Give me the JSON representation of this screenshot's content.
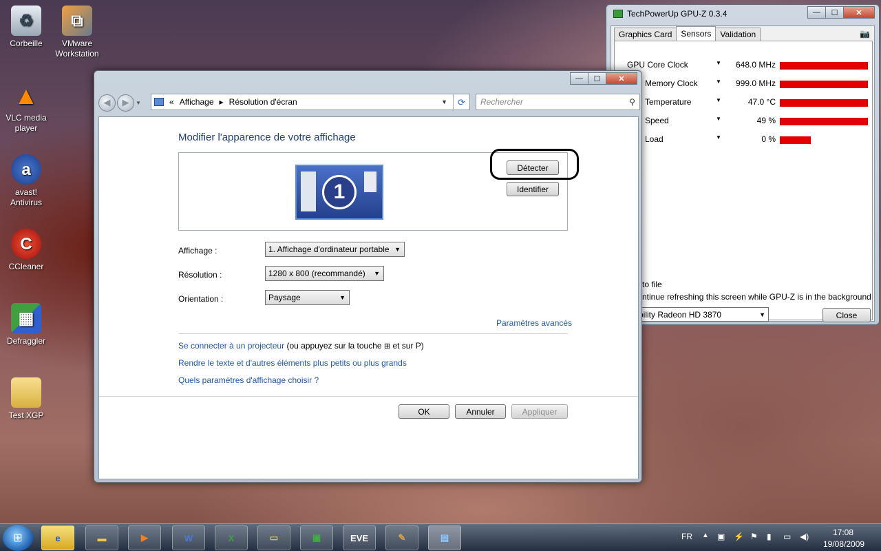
{
  "desktop": {
    "icons": [
      {
        "label": "Corbeille",
        "icon": "recycle-bin-icon"
      },
      {
        "label": "VMware Workstation",
        "icon": "vmware-icon"
      },
      {
        "label": "VLC media player",
        "icon": "vlc-icon"
      },
      {
        "label": "avast! Antivirus",
        "icon": "avast-icon"
      },
      {
        "label": "CCleaner",
        "icon": "ccleaner-icon"
      },
      {
        "label": "Defraggler",
        "icon": "defraggler-icon"
      },
      {
        "label": "Test XGP",
        "icon": "folder-icon"
      }
    ]
  },
  "explorer": {
    "breadcrumb": [
      "Affichage",
      "Résolution d'écran"
    ],
    "breadcrumb_prefix": "«",
    "search_placeholder": "Rechercher",
    "heading": "Modifier l'apparence de votre affichage",
    "monitor_number": "1",
    "detect_label": "Détecter",
    "identify_label": "Identifier",
    "display_label": "Affichage :",
    "display_value": "1. Affichage d'ordinateur portable",
    "resolution_label": "Résolution :",
    "resolution_value": "1280 x 800 (recommandé)",
    "orientation_label": "Orientation :",
    "orientation_value": "Paysage",
    "advanced_link": "Paramètres avancés",
    "projector_link": "Se connecter à un projecteur",
    "projector_hint_before": "(ou appuyez sur la touche",
    "projector_hint_after": "et sur P)",
    "text_size_link": "Rendre le texte et d'autres éléments plus petits ou plus grands",
    "which_settings_link": "Quels paramètres d'affichage choisir ?",
    "ok_label": "OK",
    "cancel_label": "Annuler",
    "apply_label": "Appliquer"
  },
  "gpuz": {
    "title": "TechPowerUp GPU-Z 0.3.4",
    "tabs": [
      "Graphics Card",
      "Sensors",
      "Validation"
    ],
    "active_tab": "Sensors",
    "sensors": [
      {
        "name": "GPU Core Clock",
        "value": "648.0 MHz",
        "level": 1.0
      },
      {
        "name": "Memory Clock",
        "value": "999.0 MHz",
        "level": 1.0
      },
      {
        "name": "Temperature",
        "value": "47.0 °C",
        "level": 1.0
      },
      {
        "name": "Speed",
        "value": "49 %",
        "level": 1.0
      },
      {
        "name": "Load",
        "value": "0 %",
        "level": 0.35
      }
    ],
    "log_to_file": "to file",
    "continue_refresh": "ntinue refreshing this screen while GPU-Z is in the background",
    "gpu_select": "bility Radeon HD 3870",
    "close_label": "Close"
  },
  "taskbar": {
    "language": "FR",
    "time": "17:08",
    "date": "19/08/2009"
  },
  "colors": {
    "link": "#1e5aa8",
    "heading": "#1e3f78",
    "sensor_bar": "#e40000"
  }
}
